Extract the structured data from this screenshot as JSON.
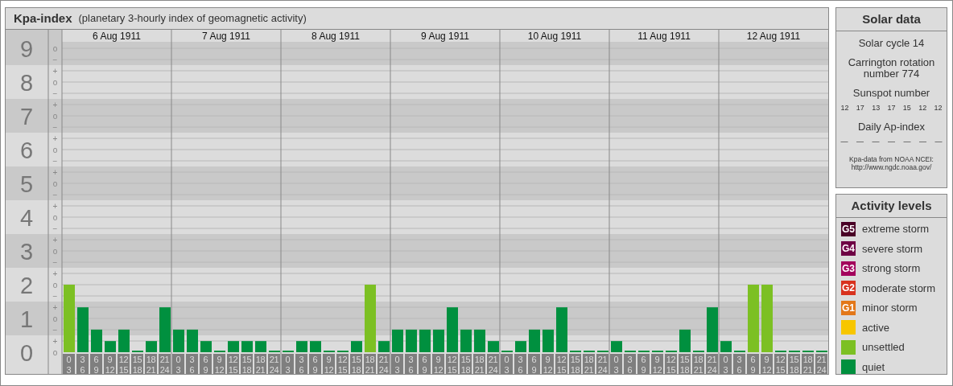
{
  "chart_panel": {
    "title": "Kpa-index",
    "subtitle": "(planetary 3-hourly index of geomagnetic activity)",
    "kp_subticks": [
      {
        "marks": [
          "o",
          "−"
        ]
      },
      {
        "marks": [
          "+",
          "o",
          "−"
        ]
      },
      {
        "marks": [
          "+",
          "o",
          "−"
        ]
      },
      {
        "marks": [
          "+",
          "o",
          "−"
        ]
      },
      {
        "marks": [
          "+",
          "o",
          "−"
        ]
      },
      {
        "marks": [
          "+",
          "o",
          "−"
        ]
      },
      {
        "marks": [
          "+",
          "o",
          "−"
        ]
      },
      {
        "marks": [
          "+",
          "o",
          "−"
        ]
      },
      {
        "marks": [
          "+",
          "o",
          "−"
        ]
      },
      {
        "marks": [
          "+",
          "o"
        ]
      }
    ],
    "days": [
      {
        "date": "6 Aug 1911"
      },
      {
        "date": "7 Aug 1911"
      },
      {
        "date": "8 Aug 1911"
      },
      {
        "date": "9 Aug 1911"
      },
      {
        "date": "10 Aug 1911"
      },
      {
        "date": "11 Aug 1911"
      },
      {
        "date": "12 Aug 1911"
      }
    ],
    "chart_data": {
      "type": "bar",
      "grid": true,
      "ylim": [
        0,
        9
      ],
      "yticks": [
        9,
        8,
        7,
        6,
        5,
        4,
        3,
        2,
        1,
        0
      ],
      "categories": [
        "0 3",
        "3 6",
        "6 9",
        "9 12",
        "12 15",
        "15 18",
        "18 21",
        "21 24",
        "0 3",
        "3 6",
        "6 9",
        "9 12",
        "12 15",
        "15 18",
        "18 21",
        "21 24",
        "0 3",
        "3 6",
        "6 9",
        "9 12",
        "12 15",
        "15 18",
        "18 21",
        "21 24",
        "0 3",
        "3 6",
        "6 9",
        "9 12",
        "12 15",
        "15 18",
        "18 21",
        "21 24",
        "0 3",
        "3 6",
        "6 9",
        "9 12",
        "12 15",
        "15 18",
        "18 21",
        "21 24",
        "0 3",
        "3 6",
        "6 9",
        "9 12",
        "12 15",
        "15 18",
        "18 21",
        "21 24",
        "0 3",
        "3 6",
        "6 9",
        "9 12",
        "12 15",
        "15 18",
        "18 21",
        "21 24"
      ],
      "values": [
        2,
        1.33,
        0.67,
        0.33,
        0.67,
        0,
        0.33,
        1.33,
        0.67,
        0.67,
        0.33,
        0,
        0.33,
        0.33,
        0.33,
        0,
        0,
        0.33,
        0.33,
        0,
        0,
        0.33,
        2,
        0.33,
        0.67,
        0.67,
        0.67,
        0.67,
        1.33,
        0.67,
        0.67,
        0.33,
        0,
        0.33,
        0.67,
        0.67,
        1.33,
        0,
        0,
        0,
        0.33,
        0,
        0,
        0,
        0,
        0.67,
        0,
        1.33,
        0.33,
        0,
        2,
        2,
        0,
        0,
        0,
        0
      ]
    }
  },
  "solar_data": {
    "title": "Solar data",
    "solar_cycle": "Solar cycle 14",
    "carrington": "Carrington rotation number 774",
    "sunspot_label": "Sunspot number",
    "sunspot_numbers": [
      "12",
      "17",
      "13",
      "17",
      "15",
      "12",
      "12"
    ],
    "ap_label": "Daily Ap-index",
    "ap_values": [
      "—",
      "—",
      "—",
      "—",
      "—",
      "—",
      "—"
    ],
    "source": "Kpa-data from NOAA NCEI:",
    "source_url": "http://www.ngdc.noaa.gov/"
  },
  "activity_levels": {
    "title": "Activity levels",
    "levels": [
      {
        "badge": "G5",
        "label": "extreme storm",
        "color": "#4a0026"
      },
      {
        "badge": "G4",
        "label": "severe storm",
        "color": "#6e0044"
      },
      {
        "badge": "G3",
        "label": "strong storm",
        "color": "#a3005c"
      },
      {
        "badge": "G2",
        "label": "moderate storm",
        "color": "#d8321e"
      },
      {
        "badge": "G1",
        "label": "minor storm",
        "color": "#e37719"
      },
      {
        "label": "active",
        "color": "#f7c600"
      },
      {
        "label": "unsettled",
        "color": "#7cc023"
      },
      {
        "label": "quiet",
        "color": "#00903f"
      }
    ]
  }
}
